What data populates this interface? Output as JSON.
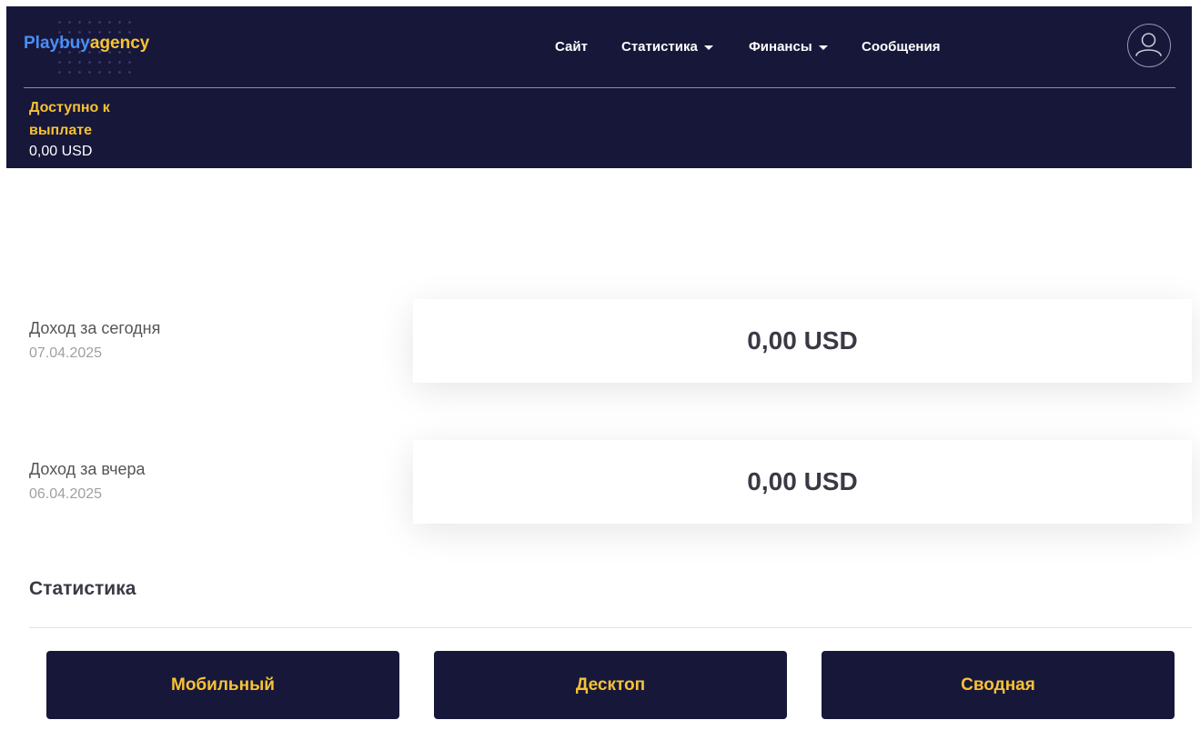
{
  "colors": {
    "header_bg": "#17173a",
    "accent_yellow": "#f7c233",
    "accent_blue": "#4a8ef5"
  },
  "header": {
    "logo": {
      "part1": "Playbuy",
      "part2": "agency"
    },
    "nav": [
      {
        "label": "Сайт",
        "has_dropdown": false
      },
      {
        "label": "Статистика",
        "has_dropdown": true
      },
      {
        "label": "Финансы",
        "has_dropdown": true
      },
      {
        "label": "Сообщения",
        "has_dropdown": false
      }
    ],
    "avatar_icon": "user-icon",
    "payout": {
      "label": "Доступно к выплате",
      "value": "0,00 USD"
    }
  },
  "income": {
    "today": {
      "label": "Доход за сегодня",
      "date": "07.04.2025",
      "value": "0,00 USD"
    },
    "yesterday": {
      "label": "Доход за вчера",
      "date": "06.04.2025",
      "value": "0,00 USD"
    }
  },
  "stats": {
    "title": "Статистика",
    "buttons": [
      {
        "label": "Мобильный"
      },
      {
        "label": "Десктоп"
      },
      {
        "label": "Сводная"
      }
    ]
  }
}
